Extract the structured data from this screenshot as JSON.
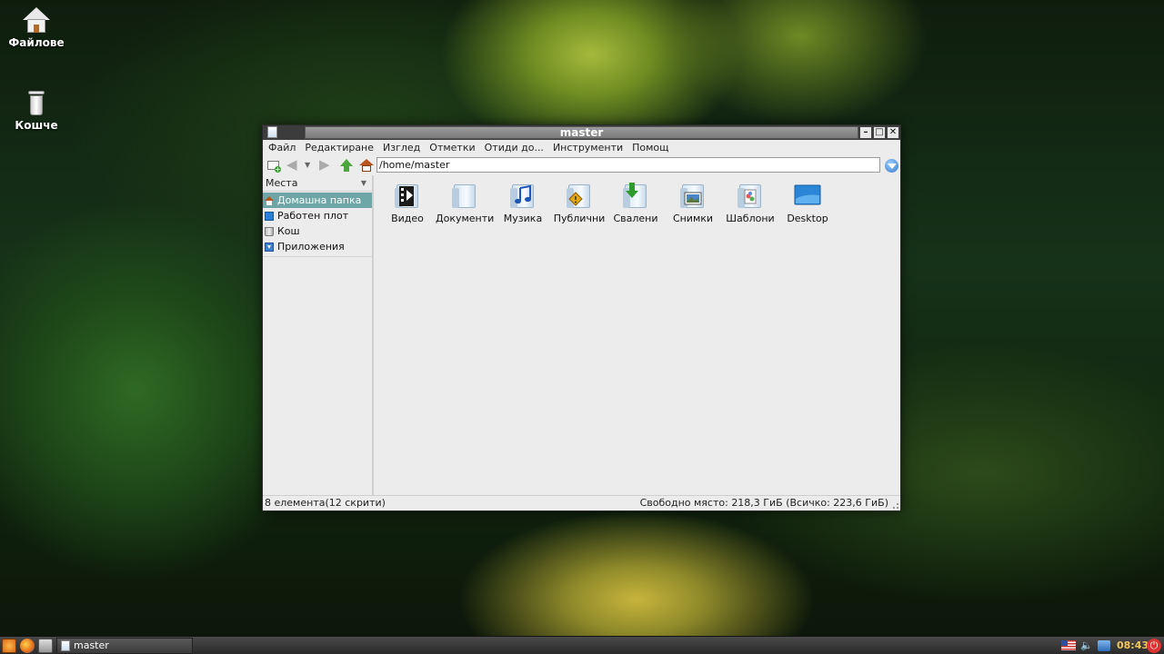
{
  "desktop": {
    "icons": [
      {
        "label": "Файлове",
        "icon": "home-folder-icon"
      },
      {
        "label": "Кошче",
        "icon": "trash-icon"
      }
    ]
  },
  "window": {
    "title": "master",
    "controls": {
      "minimize": "–",
      "maximize": "□",
      "close": "✕"
    }
  },
  "menubar": {
    "items": [
      "Файл",
      "Редактиране",
      "Изглед",
      "Отметки",
      "Отиди до...",
      "Инструменти",
      "Помощ"
    ]
  },
  "toolbar": {
    "path": "/home/master"
  },
  "sidebar": {
    "header": "Места",
    "items": [
      {
        "label": "Домашна папка",
        "icon": "home-icon",
        "selected": true
      },
      {
        "label": "Работен плот",
        "icon": "desktop-icon",
        "selected": false
      },
      {
        "label": "Кош",
        "icon": "trash-icon",
        "selected": false
      },
      {
        "label": "Приложения",
        "icon": "applications-icon",
        "selected": false
      }
    ]
  },
  "files": [
    {
      "label": "Видео",
      "icon": "video-folder-icon"
    },
    {
      "label": "Документи",
      "icon": "documents-folder-icon"
    },
    {
      "label": "Музика",
      "icon": "music-folder-icon"
    },
    {
      "label": "Публични",
      "icon": "public-folder-icon"
    },
    {
      "label": "Свалени",
      "icon": "downloads-folder-icon"
    },
    {
      "label": "Снимки",
      "icon": "pictures-folder-icon"
    },
    {
      "label": "Шаблони",
      "icon": "templates-folder-icon"
    },
    {
      "label": "Desktop",
      "icon": "desktop-folder-icon"
    }
  ],
  "statusbar": {
    "left": "8 елемента(12 скрити)",
    "right": "Свободно място: 218,3 ГиБ (Всичко: 223,6 ГиБ)"
  },
  "taskbar": {
    "task_label": "master",
    "clock": "08:43"
  },
  "colors": {
    "selection": "#6ea5a6",
    "clock": "#f0c85a"
  }
}
